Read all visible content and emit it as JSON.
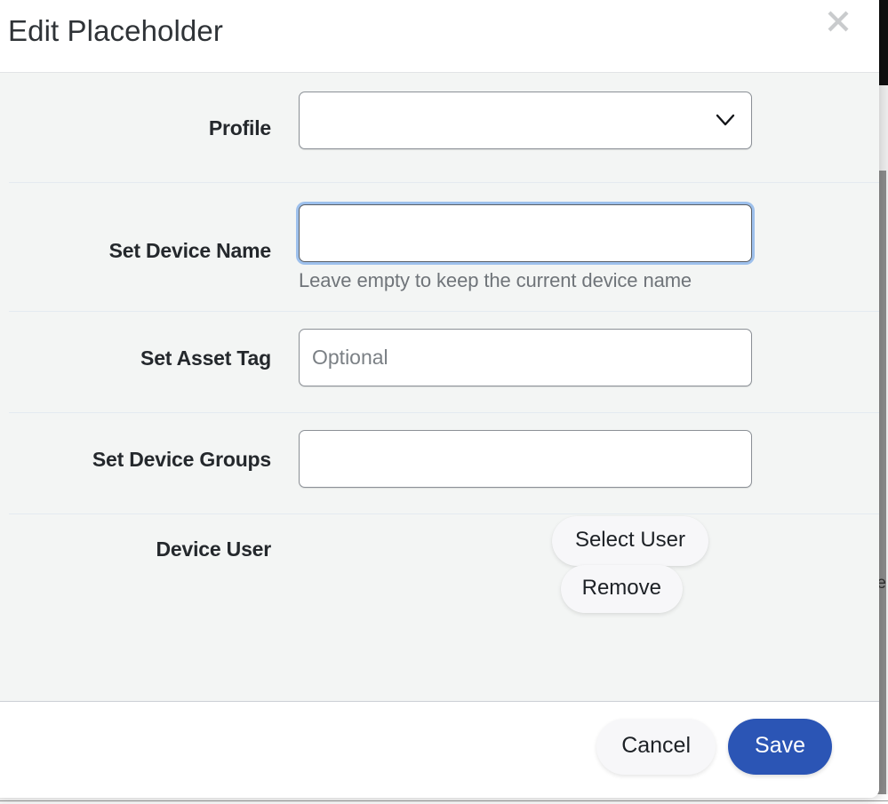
{
  "modal": {
    "title": "Edit Placeholder",
    "close_icon": "close-icon"
  },
  "form": {
    "rows": [
      {
        "label": "Profile",
        "control": "select",
        "value": "",
        "options": [
          ""
        ]
      },
      {
        "label": "Set Device Name",
        "control": "text",
        "value": "",
        "placeholder": "",
        "help": "Leave empty to keep the current device name",
        "focused": true
      },
      {
        "label": "Set Asset Tag",
        "control": "text",
        "value": "",
        "placeholder": "Optional"
      },
      {
        "label": "Set Device Groups",
        "control": "text",
        "value": "",
        "placeholder": ""
      },
      {
        "label": "Device User",
        "control": "buttons",
        "buttons": [
          {
            "label": "Select User"
          },
          {
            "label": "Remove"
          }
        ]
      }
    ]
  },
  "footer": {
    "cancel_label": "Cancel",
    "save_label": "Save"
  },
  "background": {
    "side_text": "e",
    "bottom_text": "",
    "colors": {
      "accent_blue": "#2b55b5",
      "body_bg": "#f3f5f4",
      "focus_ring": "#9dc0ec",
      "separator": "#e4eaf0"
    }
  },
  "icons": {
    "close": "close-icon",
    "chevron_down": "chevron-down-icon"
  }
}
